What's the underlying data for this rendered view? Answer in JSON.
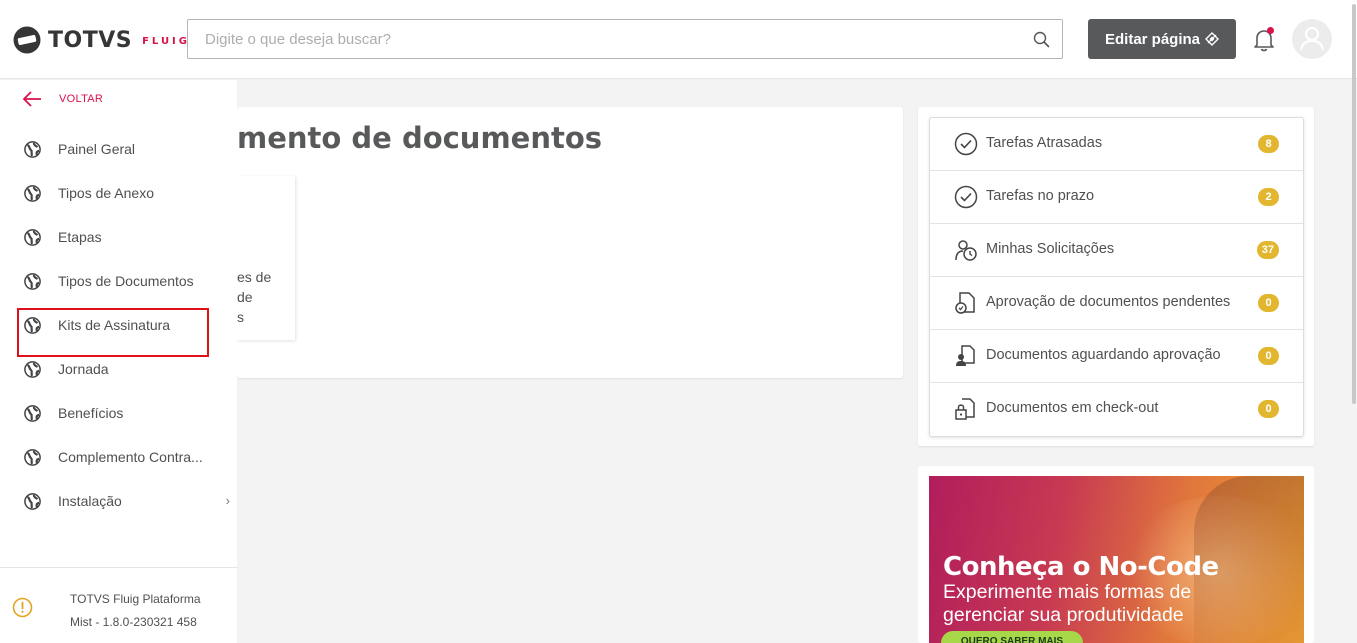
{
  "header": {
    "logo_text": "TOTVS",
    "logo_sub": "FLUIG",
    "search_placeholder": "Digite o que deseja buscar?",
    "edit_button_label": "Editar página",
    "notification_color": "#d9124a"
  },
  "sidebar": {
    "back_label": "VOLTAR",
    "items": [
      {
        "label": "Painel Geral",
        "icon": "globe-icon"
      },
      {
        "label": "Tipos de Anexo",
        "icon": "globe-icon"
      },
      {
        "label": "Etapas",
        "icon": "globe-icon"
      },
      {
        "label": "Tipos de Documentos",
        "icon": "globe-icon"
      },
      {
        "label": "Kits de Assinatura",
        "icon": "globe-icon",
        "highlighted": true
      },
      {
        "label": "Jornada",
        "icon": "globe-icon"
      },
      {
        "label": "Benefícios",
        "icon": "globe-icon"
      },
      {
        "label": "Complemento Contra...",
        "icon": "globe-icon"
      },
      {
        "label": "Instalação",
        "icon": "globe-icon",
        "has_submenu": true
      }
    ],
    "footer": {
      "line1": "TOTVS Fluig Plataforma",
      "line2": "Mist - 1.8.0-230321 458"
    }
  },
  "main": {
    "title": "mento de documentos",
    "card_text_lines": [
      "es de",
      "de",
      "s"
    ]
  },
  "tasks": [
    {
      "label": "Tarefas Atrasadas",
      "count": "8",
      "icon": "clock-check-icon"
    },
    {
      "label": "Tarefas no prazo",
      "count": "2",
      "icon": "clock-check-icon"
    },
    {
      "label": "Minhas Solicitações",
      "count": "37",
      "icon": "user-clock-icon"
    },
    {
      "label": "Aprovação de documentos pendentes",
      "count": "0",
      "icon": "document-clock-icon"
    },
    {
      "label": "Documentos aguardando aprovação",
      "count": "0",
      "icon": "document-user-icon"
    },
    {
      "label": "Documentos em check-out",
      "count": "0",
      "icon": "document-lock-icon"
    }
  ],
  "banner": {
    "title": "Conheça o No-Code",
    "subtitle_line1": "Experimente mais formas de",
    "subtitle_line2": "gerenciar sua produtividade",
    "cta": "QUERO SABER MAIS"
  },
  "colors": {
    "accent": "#d9124a",
    "badge": "#e2b62f",
    "edit_button": "#58595b",
    "highlight_border": "#e0101b"
  }
}
